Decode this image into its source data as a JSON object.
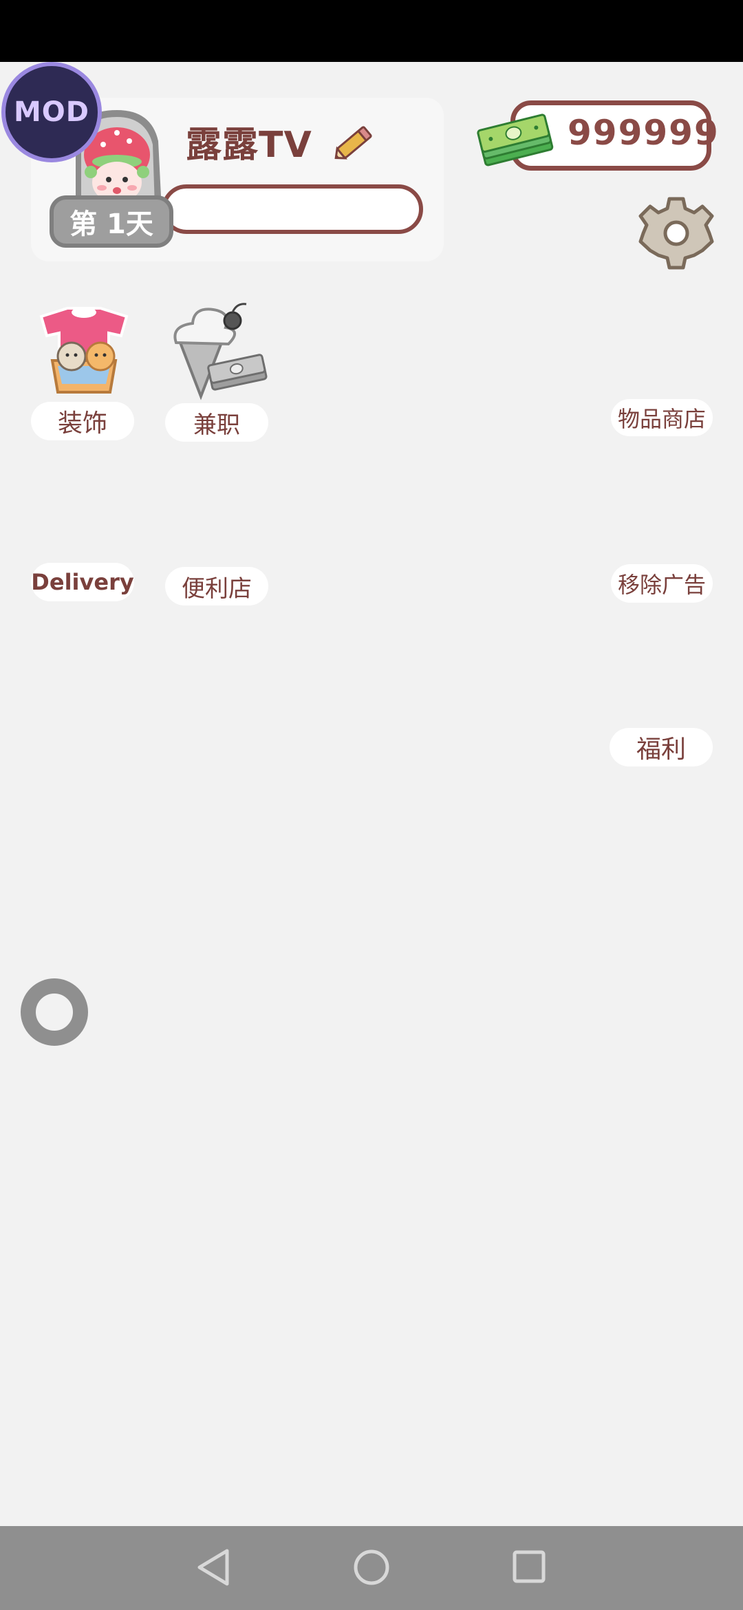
{
  "profile": {
    "username": "露露TV",
    "day_badge": "第 1天"
  },
  "currency": {
    "coins": "999999"
  },
  "overlay": {
    "mod_label": "MOD"
  },
  "menu": {
    "decorate": "装饰",
    "part_time": "兼职",
    "item_shop": "物品商店",
    "delivery": "Delivery",
    "convenience_store": "便利店",
    "remove_ads": "移除广告",
    "welfare": "福利"
  },
  "colors": {
    "accent": "#8a4a46",
    "background": "#f2f2f2",
    "navbar": "#8f8f8f"
  },
  "icons": {
    "edit": "pencil-icon",
    "coins": "cash-stack-icon",
    "settings": "gear-icon",
    "decorate": "clothes-basket-icon",
    "part_time": "ice-cream-icon",
    "loader": "loading-ring-icon",
    "back": "back-triangle-icon",
    "home": "home-circle-icon",
    "recents": "recents-square-icon"
  }
}
